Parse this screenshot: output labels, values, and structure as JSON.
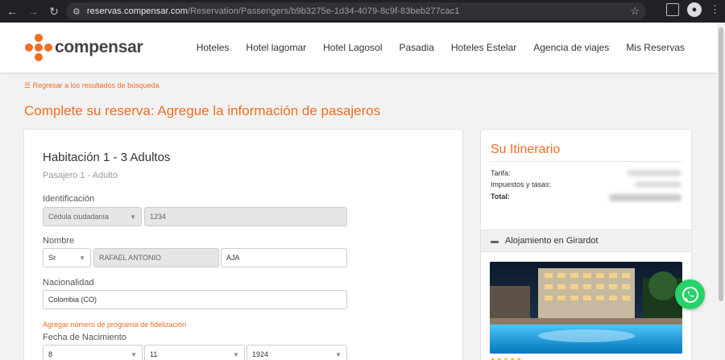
{
  "browser": {
    "url_host": "reservas.compensar.com",
    "url_path": "/Reservation/Passengers/b9b3275e-1d34-4079-8c9f-83beb277cac1"
  },
  "header": {
    "logo_text": "compensar",
    "nav": [
      "Hoteles",
      "Hotel lagomar",
      "Hotel Lagosol",
      "Pasadia",
      "Hoteles Estelar",
      "Agencia de viajes",
      "Mis Reservas"
    ]
  },
  "back_link": "Regresar a los resultados de búsqueda",
  "page_title": "Complete su reserva: Agregue la información de pasajeros",
  "form": {
    "room_title": "Habitación 1 - 3 Adultos",
    "passenger_sub": "Pasajero 1 - Adulto",
    "id_label": "Identificación",
    "id_type": "Cédula ciudadanía",
    "id_number": "1234",
    "name_label": "Nombre",
    "title_value": "Sr",
    "first_name": "RAFAEL ANTONIO",
    "last_name": "AJA",
    "nationality_label": "Nacionalidad",
    "nationality": "Colombia (CO)",
    "loyalty_link": "Agregar número de programa de fidelización",
    "dob_label": "Fecha de Nacimiento",
    "dob_day": "8",
    "dob_month": "11",
    "dob_year": "1924"
  },
  "itinerary": {
    "title": "Su Itinerario",
    "tarifa_label": "Tarifa:",
    "impuestos_label": "Impuestos y tasas:",
    "total_label": "Total:",
    "alojamiento": "Alojamiento en Girardot",
    "stars": "★★★★★"
  },
  "colors": {
    "accent": "#f26c23",
    "whatsapp": "#25d366"
  }
}
